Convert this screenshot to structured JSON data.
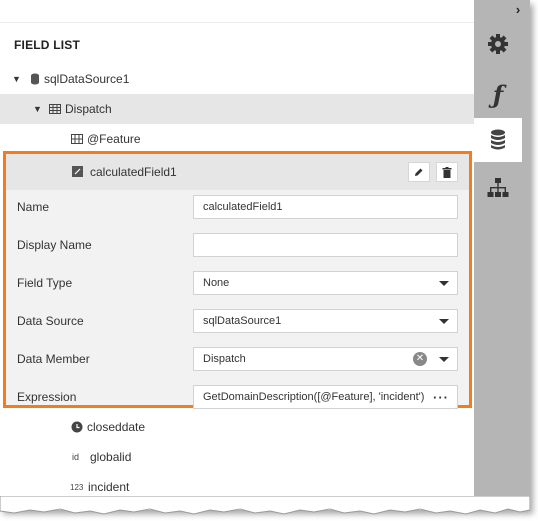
{
  "panel": {
    "title": "FIELD LIST"
  },
  "tree": {
    "datasource": "sqlDataSource1",
    "table": "Dispatch",
    "fields_before": [
      "@Feature"
    ],
    "selected_field": "calculatedField1",
    "fields_after": [
      {
        "label": "closeddate",
        "icon": "clock-icon"
      },
      {
        "label": "globalid",
        "icon": "id-icon",
        "icon_text": "id"
      },
      {
        "label": "incident",
        "icon": "number-icon",
        "icon_text": "123"
      }
    ]
  },
  "editor": {
    "name_label": "Name",
    "name_value": "calculatedField1",
    "display_name_label": "Display Name",
    "display_name_value": "",
    "field_type_label": "Field Type",
    "field_type_value": "None",
    "data_source_label": "Data Source",
    "data_source_value": "sqlDataSource1",
    "data_member_label": "Data Member",
    "data_member_value": "Dispatch",
    "expression_label": "Expression",
    "expression_value": "GetDomainDescription([@Feature], 'incident')",
    "expression_button": "···"
  },
  "sidebar": {
    "tabs": [
      {
        "name": "gear-icon",
        "active": false
      },
      {
        "name": "function-icon",
        "glyph": "ƒ",
        "active": false
      },
      {
        "name": "database-icon",
        "active": true
      },
      {
        "name": "hierarchy-icon",
        "active": false
      }
    ],
    "collapse_glyph": "›"
  },
  "colors": {
    "accent": "#f47c1f",
    "sidebar": "#b5b5b5",
    "selection": "#e6e6e6"
  }
}
